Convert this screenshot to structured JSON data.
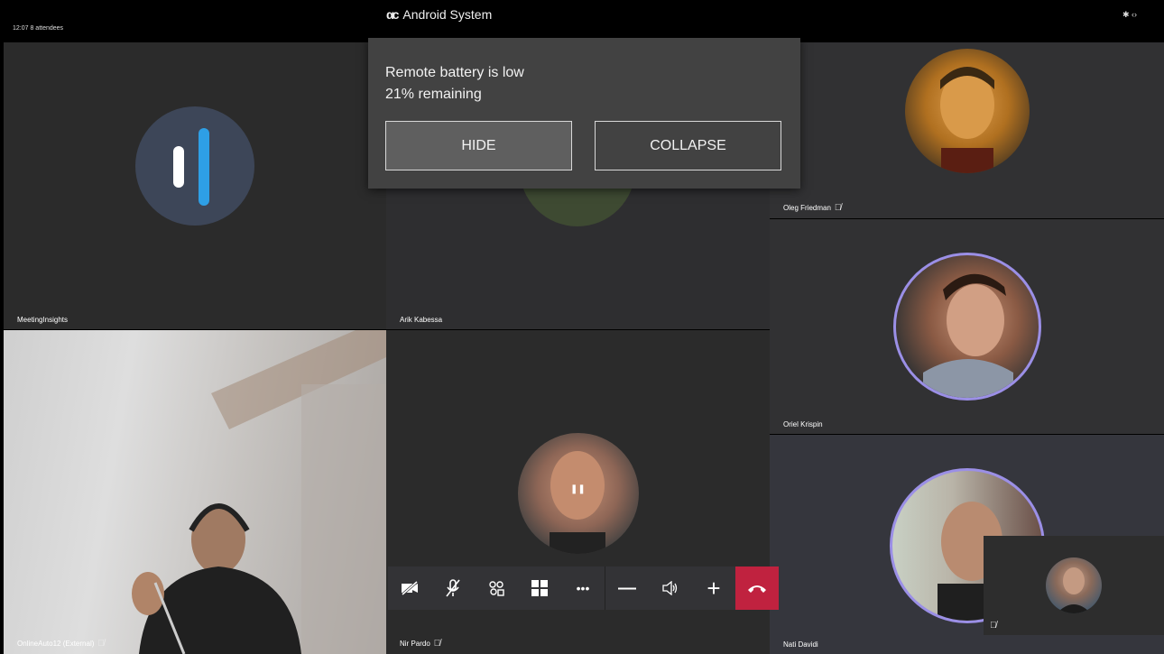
{
  "system": {
    "app_title": "Android System",
    "logo_glyph": "αc",
    "status_icons": "✱ ‹›"
  },
  "meeting": {
    "info": "12:07  8 attendees"
  },
  "dialog": {
    "line1": "Remote battery is low",
    "line2": "21% remaining",
    "hide_label": "HIDE",
    "collapse_label": "COLLAPSE"
  },
  "participants": [
    {
      "name": "MeetingInsights",
      "muted": false
    },
    {
      "name": "Arik Kabessa",
      "muted": false
    },
    {
      "name": "Oleg Friedman",
      "muted": true
    },
    {
      "name": "Oriel Krispin",
      "muted": false
    },
    {
      "name": "Nati Davidi",
      "muted": false
    },
    {
      "name": "OnlineAuto12 (External)",
      "muted": true
    },
    {
      "name": "Nir Pardo",
      "muted": true
    }
  ],
  "icons": {
    "mic_off": "mic-off-icon",
    "pause_glyph": "❚❚"
  },
  "toolbar": {
    "camera_off": "camera-off-icon",
    "mic_off": "mic-off-icon",
    "participants": "participants-icon",
    "layout": "layout-icon",
    "more": "•••",
    "volume_down": "—",
    "speaker": "speaker-icon",
    "volume_up": "+",
    "hangup": "hang-up-icon"
  },
  "colors": {
    "hangup": "#c0223f",
    "ring": "#9b8fe6",
    "insights_accent": "#2e9fe6"
  }
}
